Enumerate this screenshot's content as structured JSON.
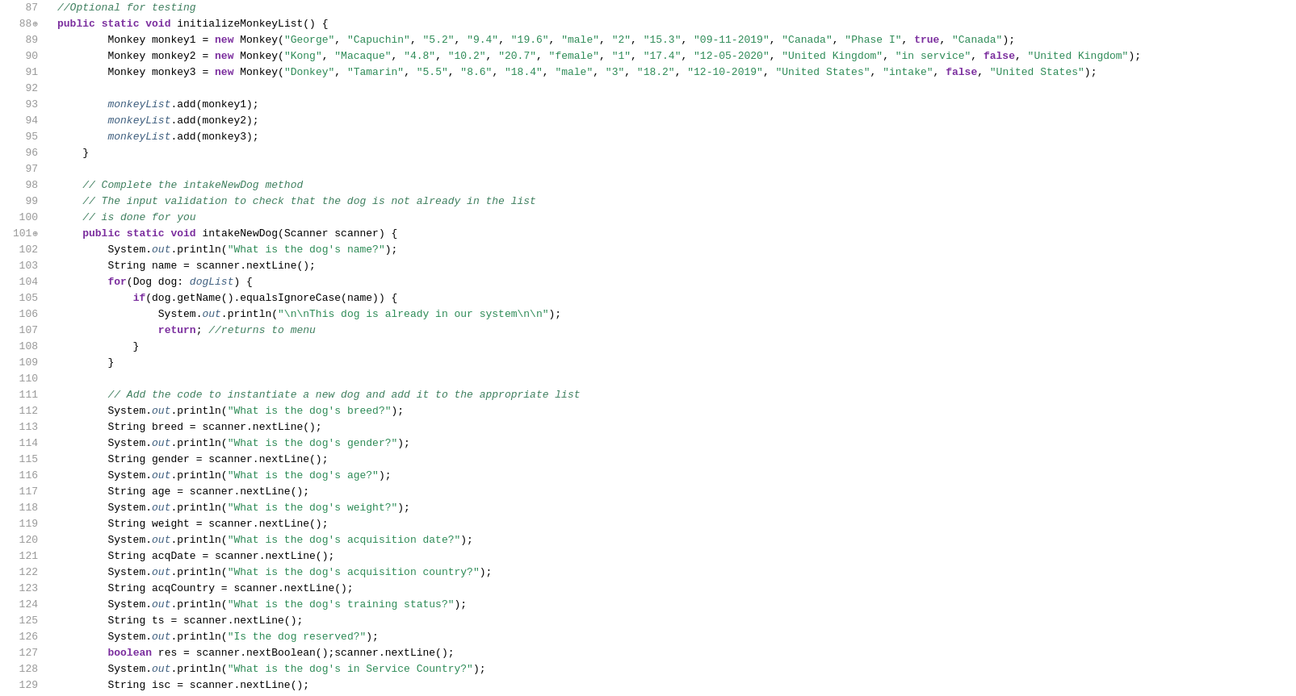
{
  "editor": {
    "lines": [
      {
        "num": 87,
        "content": "    <comment>//Optional for testing</comment>"
      },
      {
        "num": 88,
        "content": "    <kw>public</kw> <kw>static</kw> <kw>void</kw> initializeMonkeyList() {",
        "breakpoint": true
      },
      {
        "num": 89,
        "content": "        Monkey monkey1 = <kw>new</kw> Monkey(<str>\"George\"</str>, <str>\"Capuchin\"</str>, <str>\"5.2\"</str>, <str>\"9.4\"</str>, <str>\"19.6\"</str>, <str>\"male\"</str>, <str>\"2\"</str>, <str>\"15.3\"</str>, <str>\"09-11-2019\"</str>, <str>\"Canada\"</str>, <str>\"Phase I\"</str>, <kw>true</kw>, <str>\"Canada\"</str>);"
      },
      {
        "num": 90,
        "content": "        Monkey monkey2 = <kw>new</kw> Monkey(<str>\"Kong\"</str>, <str>\"Macaque\"</str>, <str>\"4.8\"</str>, <str>\"10.2\"</str>, <str>\"20.7\"</str>, <str>\"female\"</str>, <str>\"1\"</str>, <str>\"17.4\"</str>, <str>\"12-05-2020\"</str>, <str>\"United Kingdom\"</str>, <str>\"in service\"</str>, <kw>false</kw>, <str>\"United Kingdom\"</str>);"
      },
      {
        "num": 91,
        "content": "        Monkey monkey3 = <kw>new</kw> Monkey(<str>\"Donkey\"</str>, <str>\"Tamarin\"</str>, <str>\"5.5\"</str>, <str>\"8.6\"</str>, <str>\"18.4\"</str>, <str>\"male\"</str>, <str>\"3\"</str>, <str>\"18.2\"</str>, <str>\"12-10-2019\"</str>, <str>\"United States\"</str>, <str>\"intake\"</str>, <kw>false</kw>, <str>\"United States\"</str>);"
      },
      {
        "num": 92,
        "content": ""
      },
      {
        "num": 93,
        "content": "        <italic>monkeyList</italic>.add(monkey1);"
      },
      {
        "num": 94,
        "content": "        <italic>monkeyList</italic>.add(monkey2);"
      },
      {
        "num": 95,
        "content": "        <italic>monkeyList</italic>.add(monkey3);"
      },
      {
        "num": 96,
        "content": "    }"
      },
      {
        "num": 97,
        "content": ""
      },
      {
        "num": 98,
        "content": "    <comment>// Complete the intakeNewDog method</comment>"
      },
      {
        "num": 99,
        "content": "    <comment>// The input validation to check that the dog is not already in the list</comment>"
      },
      {
        "num": 100,
        "content": "    <comment>// is done for you</comment>"
      },
      {
        "num": 101,
        "content": "    <kw>public</kw> <kw>static</kw> <kw>void</kw> intakeNewDog(Scanner scanner) {",
        "breakpoint": true
      },
      {
        "num": 102,
        "content": "        System.<italic>out</italic>.println(<str>\"What is the dog's name?\"</str>);"
      },
      {
        "num": 103,
        "content": "        String name = scanner.nextLine();"
      },
      {
        "num": 104,
        "content": "        <kw>for</kw>(Dog dog: <italic>dogList</italic>) {"
      },
      {
        "num": 105,
        "content": "            <kw>if</kw>(dog.getName().equalsIgnoreCase(name)) {"
      },
      {
        "num": 106,
        "content": "                System.<italic>out</italic>.println(<str>\"\\n\\nThis dog is already in our system\\n\\n\"</str>);"
      },
      {
        "num": 107,
        "content": "                <kw>return</kw>; <comment>//returns to menu</comment>"
      },
      {
        "num": 108,
        "content": "            }"
      },
      {
        "num": 109,
        "content": "        }"
      },
      {
        "num": 110,
        "content": ""
      },
      {
        "num": 111,
        "content": "        <comment>// Add the code to instantiate a new dog and add it to the appropriate list</comment>"
      },
      {
        "num": 112,
        "content": "        System.<italic>out</italic>.println(<str>\"What is the dog's breed?\"</str>);"
      },
      {
        "num": 113,
        "content": "        String breed = scanner.nextLine();"
      },
      {
        "num": 114,
        "content": "        System.<italic>out</italic>.println(<str>\"What is the dog's gender?\"</str>);"
      },
      {
        "num": 115,
        "content": "        String gender = scanner.nextLine();"
      },
      {
        "num": 116,
        "content": "        System.<italic>out</italic>.println(<str>\"What is the dog's age?\"</str>);"
      },
      {
        "num": 117,
        "content": "        String age = scanner.nextLine();"
      },
      {
        "num": 118,
        "content": "        System.<italic>out</italic>.println(<str>\"What is the dog's weight?\"</str>);"
      },
      {
        "num": 119,
        "content": "        String weight = scanner.nextLine();"
      },
      {
        "num": 120,
        "content": "        System.<italic>out</italic>.println(<str>\"What is the dog's acquisition date?\"</str>);"
      },
      {
        "num": 121,
        "content": "        String acqDate = scanner.nextLine();"
      },
      {
        "num": 122,
        "content": "        System.<italic>out</italic>.println(<str>\"What is the dog's acquisition country?\"</str>);"
      },
      {
        "num": 123,
        "content": "        String acqCountry = scanner.nextLine();"
      },
      {
        "num": 124,
        "content": "        System.<italic>out</italic>.println(<str>\"What is the dog's training status?\"</str>);"
      },
      {
        "num": 125,
        "content": "        String ts = scanner.nextLine();"
      },
      {
        "num": 126,
        "content": "        System.<italic>out</italic>.println(<str>\"Is the dog reserved?\"</str>);"
      },
      {
        "num": 127,
        "content": "        <kw>boolean</kw> res = scanner.nextBoolean();scanner.nextLine();"
      },
      {
        "num": 128,
        "content": "        System.<italic>out</italic>.println(<str>\"What is the dog's in Service Country?\"</str>);"
      },
      {
        "num": 129,
        "content": "        String isc = scanner.nextLine();"
      }
    ]
  }
}
